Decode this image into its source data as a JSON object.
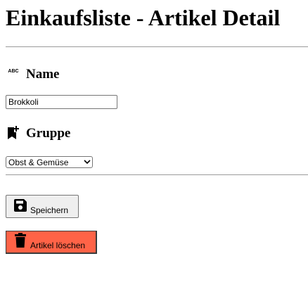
{
  "page": {
    "title": "Einkaufsliste - Artikel Detail"
  },
  "form": {
    "name": {
      "icon": "abc-text-icon",
      "label": "Name",
      "value": "Brokkoli"
    },
    "group": {
      "icon": "bookmark-add-icon",
      "label": "Gruppe",
      "selected": "Obst & Gemüse"
    }
  },
  "actions": {
    "save_label": "Speichern",
    "save_icon": "floppy-disk-icon",
    "delete_label": "Artikel löschen",
    "delete_icon": "trash-icon",
    "delete_color": "#ff6347"
  }
}
